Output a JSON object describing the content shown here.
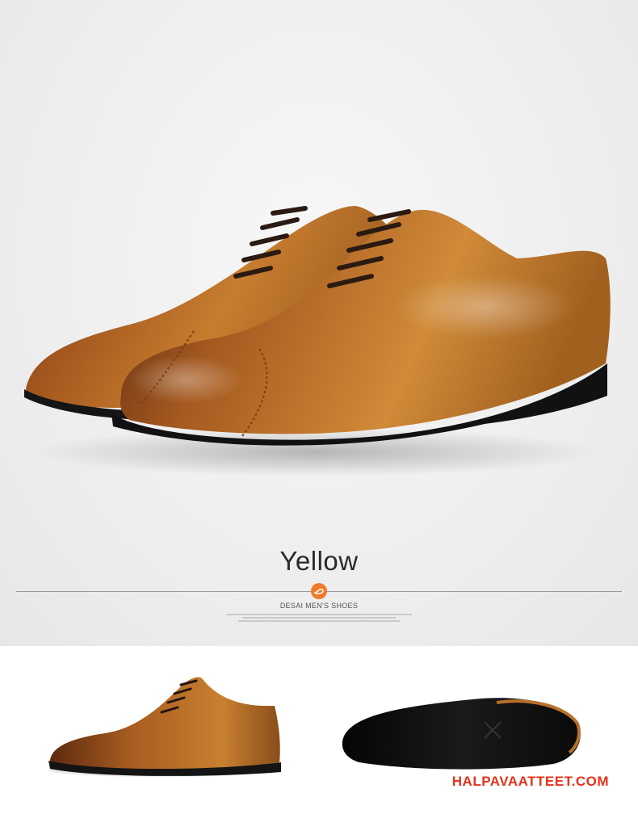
{
  "product": {
    "color_name": "Yellow",
    "brand_line": "DESAI MEN'S SHOES"
  },
  "icons": {
    "badge": "shoe-logo-icon"
  },
  "colors": {
    "leather": "#b8702a",
    "badge": "#ee7b2a",
    "watermark": "#e4321b"
  },
  "watermark": {
    "text": "HALPAVAATTEET.COM"
  }
}
